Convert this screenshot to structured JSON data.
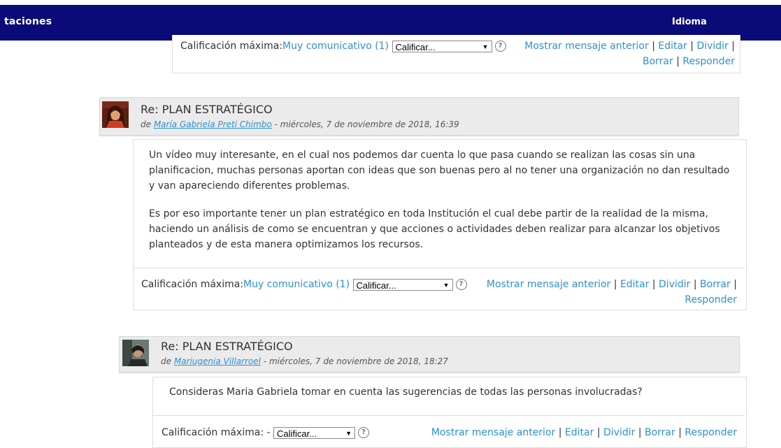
{
  "topbar": {
    "left_text": "taciones",
    "right_text": "Idioma"
  },
  "common": {
    "rating_label": "Calificación máxima:",
    "select_value": "Calificar...",
    "show_parent": "Mostrar mensaje anterior",
    "edit": "Editar",
    "split": "Dividir",
    "delete": "Borrar",
    "reply": "Responder",
    "separator": "|"
  },
  "post0": {
    "rating_value": "Muy comunicativo (1)"
  },
  "post1": {
    "subject": "Re: PLAN ESTRATÉGICO",
    "by": "de",
    "author": "María Gabriela Preti Chimbo",
    "date": "- miércoles, 7 de noviembre de 2018, 16:39",
    "rating_value": "Muy comunicativo (1)",
    "paragraphs": [
      "Un vídeo muy interesante, en el cual nos podemos dar cuenta lo que pasa cuando se realizan las cosas sin una planificacion, muchas personas aportan con ideas que son buenas pero al no tener una organización no dan resultado y van apareciendo diferentes problemas.",
      "Es por eso importante tener un plan estratégico en toda Institución el cual debe partir de la realidad de la misma, haciendo un análisis de como se encuentran y que acciones o actividades deben realizar para alcanzar los objetivos planteados y  de esta manera optimizamos los recursos."
    ]
  },
  "post2": {
    "subject": "Re: PLAN ESTRATÉGICO",
    "by": "de",
    "author": "Mariugenia Villarroel",
    "date": "- miércoles, 7 de noviembre de 2018, 18:27",
    "rating_value": "-",
    "paragraphs": [
      "Consideras Maria Gabriela tomar en cuenta las sugerencias de todas las personas involucradas?"
    ]
  }
}
